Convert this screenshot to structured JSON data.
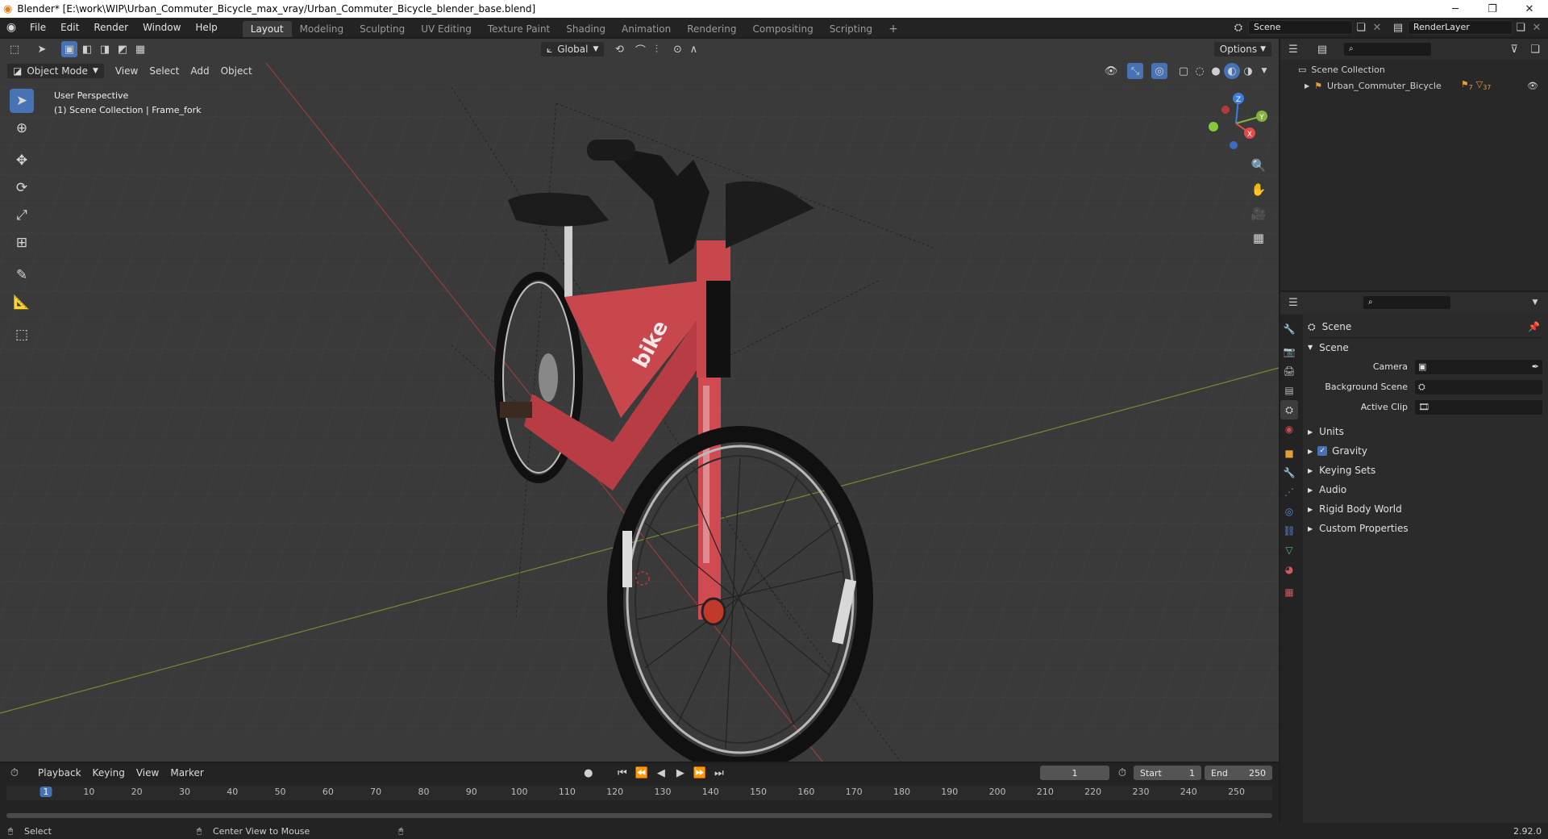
{
  "window": {
    "title": "Blender* [E:\\work\\WIP\\Urban_Commuter_Bicycle_max_vray/Urban_Commuter_Bicycle_blender_base.blend]"
  },
  "menubar": {
    "items": [
      "File",
      "Edit",
      "Render",
      "Window",
      "Help"
    ],
    "workspaces": [
      "Layout",
      "Modeling",
      "Sculpting",
      "UV Editing",
      "Texture Paint",
      "Shading",
      "Animation",
      "Rendering",
      "Compositing",
      "Scripting"
    ],
    "active_workspace": "Layout",
    "scene_name": "Scene",
    "view_layer": "RenderLayer"
  },
  "viewport": {
    "mode": "Object Mode",
    "menus": [
      "View",
      "Select",
      "Add",
      "Object"
    ],
    "orientation": "Global",
    "options_label": "Options",
    "overlay_line1": "User Perspective",
    "overlay_line2": "(1) Scene Collection | Frame_fork",
    "gizmo": {
      "x": "X",
      "y": "Y",
      "z": "Z"
    },
    "bike_text": "bike"
  },
  "outliner": {
    "root": "Scene Collection",
    "items": [
      {
        "name": "Urban_Commuter_Bicycle",
        "count": "7",
        "count2": "37"
      }
    ]
  },
  "properties": {
    "context": "Scene",
    "panel": "Scene",
    "fields": [
      {
        "label": "Camera",
        "value": ""
      },
      {
        "label": "Background Scene",
        "value": ""
      },
      {
        "label": "Active Clip",
        "value": ""
      }
    ],
    "subpanels": [
      "Units",
      "Gravity",
      "Keying Sets",
      "Audio",
      "Rigid Body World",
      "Custom Properties"
    ],
    "gravity_checked": true,
    "accent_color": "#4772b3"
  },
  "timeline": {
    "menus": [
      "Playback",
      "Keying",
      "View",
      "Marker"
    ],
    "current_frame": "1",
    "start_label": "Start",
    "start": "1",
    "end_label": "End",
    "end": "250",
    "ruler": [
      "1",
      "10",
      "20",
      "30",
      "40",
      "50",
      "60",
      "70",
      "80",
      "90",
      "100",
      "110",
      "120",
      "130",
      "140",
      "150",
      "160",
      "170",
      "180",
      "190",
      "200",
      "210",
      "220",
      "230",
      "240",
      "250"
    ]
  },
  "statusbar": {
    "left": "Select",
    "middle": "Center View to Mouse",
    "version": "2.92.0"
  }
}
